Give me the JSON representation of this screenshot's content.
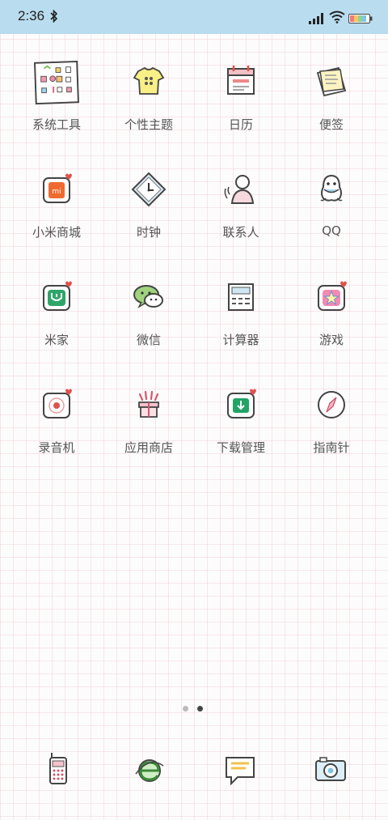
{
  "status_bar": {
    "time": "2:36",
    "icons": [
      "bluetooth-icon",
      "signal-icon",
      "wifi-icon",
      "battery-icon"
    ]
  },
  "apps": [
    {
      "label": "系统工具",
      "icon": "tools-folder-icon"
    },
    {
      "label": "个性主题",
      "icon": "theme-shirt-icon"
    },
    {
      "label": "日历",
      "icon": "calendar-icon"
    },
    {
      "label": "便签",
      "icon": "notes-icon"
    },
    {
      "label": "小米商城",
      "icon": "mi-store-icon"
    },
    {
      "label": "时钟",
      "icon": "clock-icon"
    },
    {
      "label": "联系人",
      "icon": "contacts-icon"
    },
    {
      "label": "QQ",
      "icon": "qq-icon"
    },
    {
      "label": "米家",
      "icon": "mijia-icon"
    },
    {
      "label": "微信",
      "icon": "wechat-icon"
    },
    {
      "label": "计算器",
      "icon": "calculator-icon"
    },
    {
      "label": "游戏",
      "icon": "games-icon"
    },
    {
      "label": "录音机",
      "icon": "recorder-icon"
    },
    {
      "label": "应用商店",
      "icon": "app-store-icon"
    },
    {
      "label": "下载管理",
      "icon": "download-icon"
    },
    {
      "label": "指南针",
      "icon": "compass-icon"
    }
  ],
  "page_indicator": {
    "pages": 2,
    "current": 2
  },
  "dock": [
    "phone-icon",
    "browser-icon",
    "messages-icon",
    "camera-icon"
  ],
  "colors": {
    "statusbar": "#b9dcef",
    "label": "#555555",
    "accent_red": "#e0524a",
    "accent_green": "#2ea66a"
  }
}
